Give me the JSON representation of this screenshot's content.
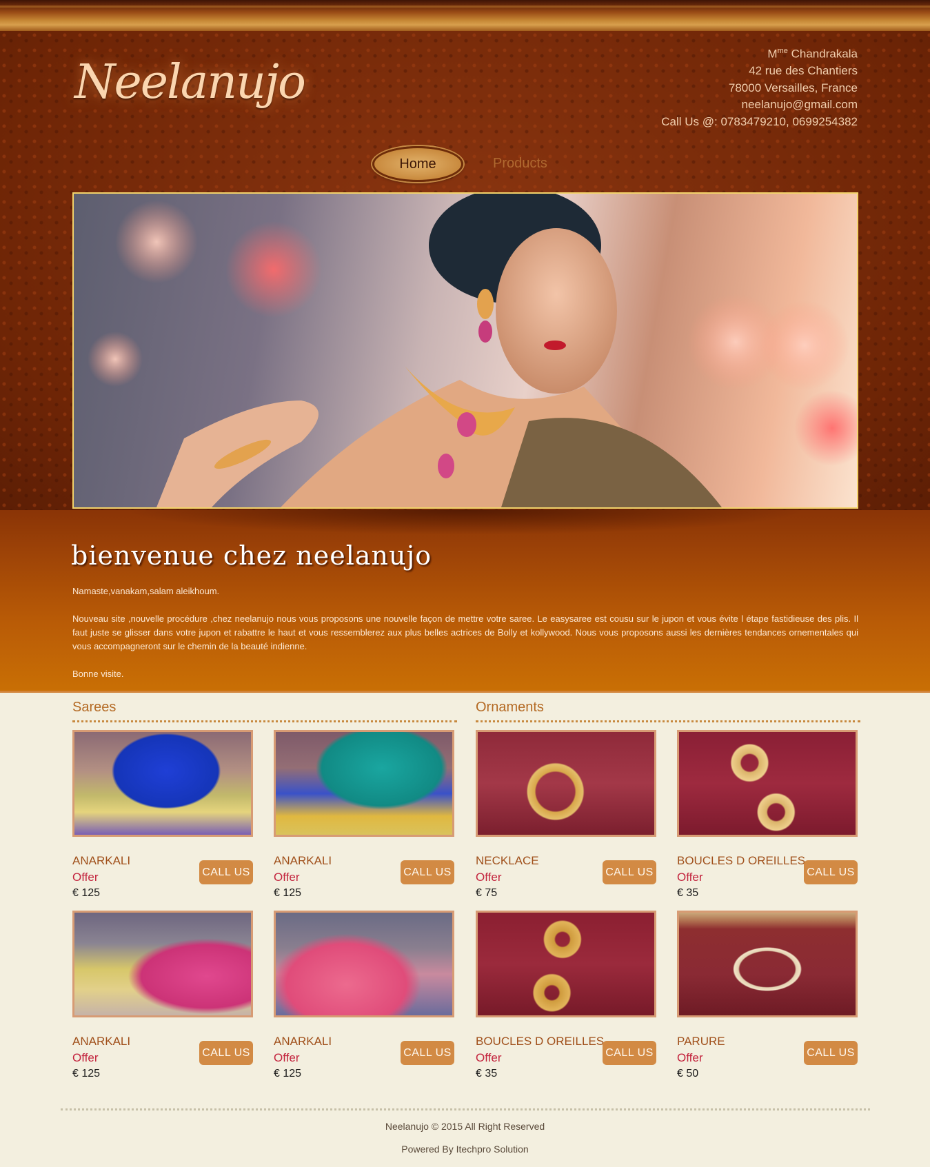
{
  "header": {
    "logo_text": "Neelanujo",
    "contact": {
      "name_prefix": "M",
      "name_sup": "me",
      "name": " Chandrakala",
      "street": "42 rue des Chantiers",
      "city": "78000 Versailles, France",
      "email": "neelanujo@gmail.com",
      "phone": "Call Us @: 0783479210, 0699254382"
    }
  },
  "nav": {
    "items": [
      {
        "label": "Home",
        "active": true
      },
      {
        "label": "Products",
        "active": false
      }
    ]
  },
  "welcome": {
    "title": "bienvenue chez neelanujo",
    "greeting": "Namaste,vanakam,salam aleikhoum.",
    "body": "Nouveau site ,nouvelle procédure ,chez neelanujo nous vous proposons une nouvelle façon de mettre votre saree. Le easysaree est cousu sur le jupon et vous évite l étape fastidieuse des plis. Il faut juste se glisser dans votre jupon et rabattre le haut et vous ressemblerez aux plus belles actrices de Bolly et kollywood. Nous vous proposons aussi les dernières tendances ornementales qui vous accompagneront sur le chemin de la beauté indienne.",
    "closing": "Bonne visite."
  },
  "sections": [
    {
      "title": "Sarees",
      "products": [
        {
          "name": "ANARKALI",
          "offer": "Offer",
          "price": "€ 125",
          "button": "CALL US"
        },
        {
          "name": "ANARKALI",
          "offer": "Offer",
          "price": "€ 125",
          "button": "CALL US"
        },
        {
          "name": "ANARKALI",
          "offer": "Offer",
          "price": "€ 125",
          "button": "CALL US"
        },
        {
          "name": "ANARKALI",
          "offer": "Offer",
          "price": "€ 125",
          "button": "CALL US"
        }
      ]
    },
    {
      "title": "Ornaments",
      "products": [
        {
          "name": "NECKLACE",
          "offer": "Offer",
          "price": "€ 75",
          "button": "CALL US"
        },
        {
          "name": "BOUCLES D OREILLES",
          "offer": "Offer",
          "price": "€ 35",
          "button": "CALL US"
        },
        {
          "name": "BOUCLES D OREILLES",
          "offer": "Offer",
          "price": "€ 35",
          "button": "CALL US"
        },
        {
          "name": "PARURE",
          "offer": "Offer",
          "price": "€ 50",
          "button": "CALL US"
        }
      ]
    }
  ],
  "footer": {
    "copyright": "Neelanujo © 2015 All Right Reserved",
    "powered": "Powered By Itechpro Solution"
  },
  "colors": {
    "header_bg": "#7a2c08",
    "welcome_bg": "#b85a06",
    "page_bg": "#f3efdf",
    "accent": "#d28a44",
    "offer": "#c3233d",
    "product_name": "#a0501b",
    "section_title": "#b46a24"
  }
}
